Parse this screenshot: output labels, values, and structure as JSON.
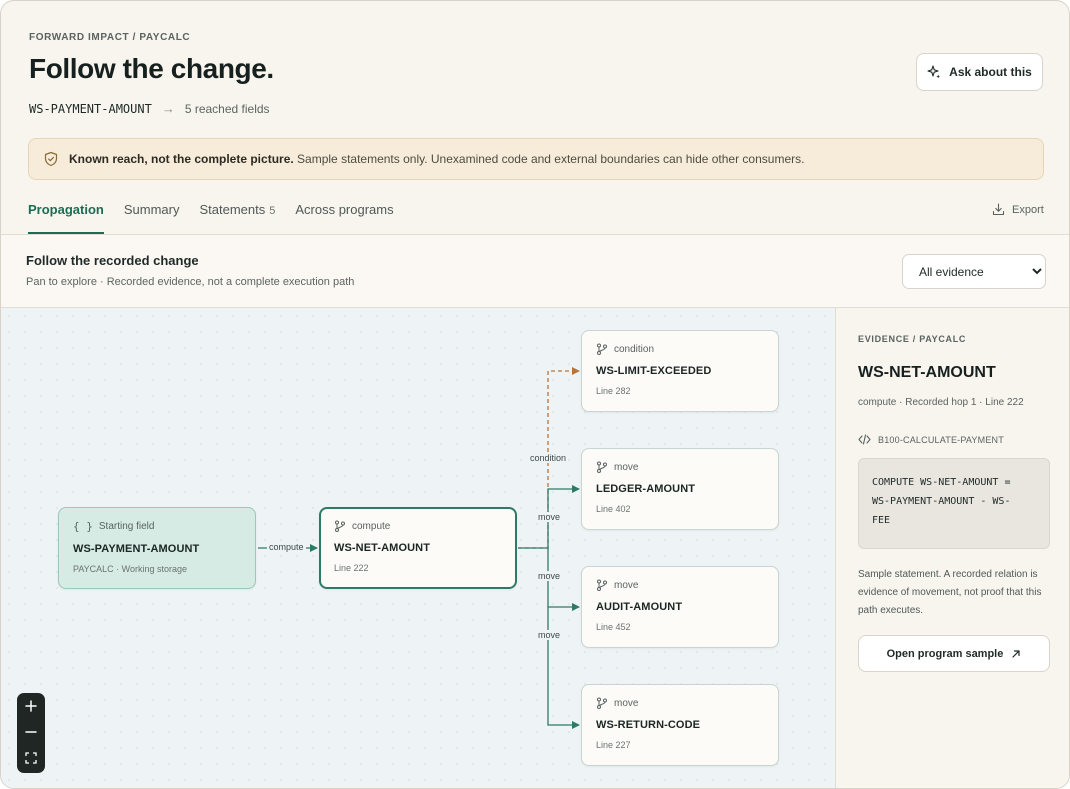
{
  "header": {
    "breadcrumb": "FORWARD IMPACT / PAYCALC",
    "title": "Follow the change.",
    "source_field": "WS-PAYMENT-AMOUNT",
    "reached": "5 reached fields",
    "ask_label": "Ask about this"
  },
  "notice": {
    "strong": "Known reach, not the complete picture.",
    "text": "Sample statements only. Unexamined code and external boundaries can hide other consumers."
  },
  "tabs": [
    {
      "label": "Propagation",
      "count": ""
    },
    {
      "label": "Summary",
      "count": ""
    },
    {
      "label": "Statements",
      "count": "5"
    },
    {
      "label": "Across programs",
      "count": ""
    }
  ],
  "export_label": "Export",
  "section": {
    "title": "Follow the recorded change",
    "subtitle": "Pan to explore · Recorded evidence, not a complete execution path",
    "filter_value": "All evidence"
  },
  "graph": {
    "start": {
      "kind": "Starting field",
      "name": "WS-PAYMENT-AMOUNT",
      "meta": "PAYCALC · Working storage"
    },
    "hop": {
      "kind": "compute",
      "name": "WS-NET-AMOUNT",
      "meta": "Line 222"
    },
    "targets": [
      {
        "kind": "condition",
        "name": "WS-LIMIT-EXCEEDED",
        "meta": "Line 282"
      },
      {
        "kind": "move",
        "name": "LEDGER-AMOUNT",
        "meta": "Line 402"
      },
      {
        "kind": "move",
        "name": "AUDIT-AMOUNT",
        "meta": "Line 452"
      },
      {
        "kind": "move",
        "name": "WS-RETURN-CODE",
        "meta": "Line 227"
      }
    ],
    "edge_labels": {
      "compute": "compute",
      "condition": "condition",
      "move1": "move",
      "move2": "move",
      "move3": "move"
    }
  },
  "panel": {
    "breadcrumb": "EVIDENCE / PAYCALC",
    "title": "WS-NET-AMOUNT",
    "meta": "compute · Recorded hop 1 · Line 222",
    "paragraph": "B100-CALCULATE-PAYMENT",
    "code": [
      "COMPUTE WS-NET-AMOUNT =",
      "WS-PAYMENT-AMOUNT - WS-",
      "FEE"
    ],
    "note": "Sample statement. A recorded relation is evidence of movement, not proof that this path executes.",
    "open_label": "Open program sample"
  },
  "colors": {
    "accent": "#1e6b55",
    "edge": "#2f7a66",
    "condition_edge": "#b8743a",
    "start_node_bg": "#d5ebe3",
    "notice_bg": "#f7ecd9"
  },
  "icons": {
    "ask": "sparkle-icon",
    "notice": "shield-check-icon",
    "export": "download-icon",
    "start": "braces-icon",
    "branch": "git-branch-icon",
    "code": "code-icon",
    "external": "arrow-up-right-icon"
  }
}
